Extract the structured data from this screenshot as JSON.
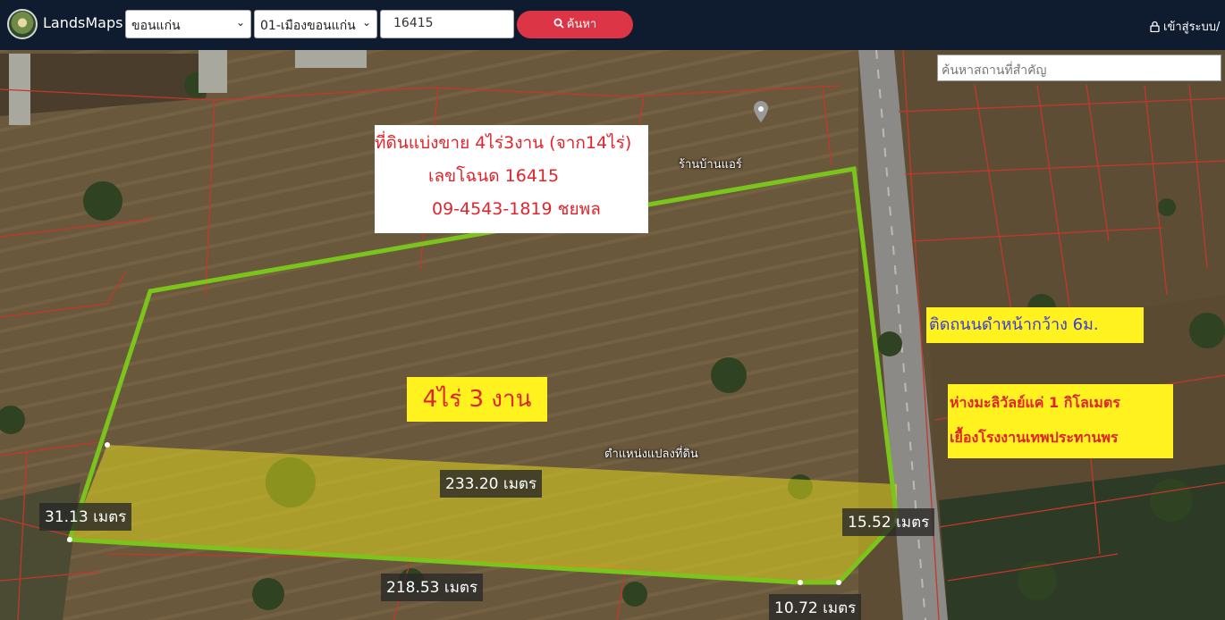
{
  "header": {
    "brand": "LandsMaps",
    "province": "ขอนแก่น",
    "district": "01-เมืองขอนแก่น",
    "parcel_number": "16415",
    "search_label": "ค้นหา",
    "login_label": "เข้าสู่ระบบ/"
  },
  "map": {
    "place_search_placeholder": "ค้นหาสถานที่สำคัญ",
    "poi_label": "ร้านบ้านแอร์",
    "parcel_position_label": "ตำแหน่งแปลงที่ดิน",
    "measurements": {
      "top": "233.20 เมตร",
      "left": "31.13 เมตร",
      "right": "15.52 เมตร",
      "bottom": "218.53 เมตร",
      "corner": "10.72 เมตร"
    }
  },
  "overlay": {
    "title_line1": "ที่ดินแบ่งขาย 4ไร่3งาน (จาก14ไร่)",
    "title_line2": "เลขโฉนด 16415",
    "title_line3": "09-4543-1819 ชยพล",
    "area_label": "4ไร่ 3 งาน",
    "road_note": "ติดถนนดำหน้ากว้าง 6ม.",
    "nearby_line1": "ห่างมะลิวัลย์แค่ 1 กิโลเมตร",
    "nearby_line2": "เยื้องโรงงานเทพประทานพร"
  }
}
